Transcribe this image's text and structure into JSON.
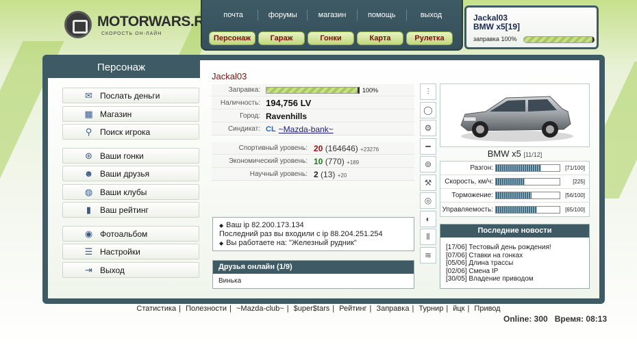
{
  "logo": {
    "title": "MOTORWARS.RU",
    "subtitle": "СКОРОСТЬ ОН-ЛАЙН"
  },
  "topnav": {
    "links": [
      "почта",
      "форумы",
      "магазин",
      "помощь",
      "выход"
    ],
    "buttons": [
      "Персонаж",
      "Гараж",
      "Гонки",
      "Карта",
      "Рулетка"
    ]
  },
  "userbox": {
    "name": "Jackal03",
    "car": "BMW x5[19]",
    "fuel_label": "заправка 100%",
    "fuel_fraction": 1.0
  },
  "sidebar": {
    "title": "Персонаж",
    "groups": [
      [
        {
          "label": "Послать деньги",
          "icon": "money-icon"
        },
        {
          "label": "Магазин",
          "icon": "shop-icon"
        },
        {
          "label": "Поиск игрока",
          "icon": "search-icon"
        }
      ],
      [
        {
          "label": "Ваши гонки",
          "icon": "steering-wheel-icon"
        },
        {
          "label": "Ваши друзья",
          "icon": "friends-icon"
        },
        {
          "label": "Ваши клубы",
          "icon": "globe-icon"
        },
        {
          "label": "Ваш рейтинг",
          "icon": "chart-icon"
        }
      ],
      [
        {
          "label": "Фотоальбом",
          "icon": "camera-icon"
        },
        {
          "label": "Настройки",
          "icon": "sliders-icon"
        },
        {
          "label": "Выход",
          "icon": "exit-icon"
        }
      ]
    ]
  },
  "character": {
    "name": "Jackal03",
    "fuel": {
      "label": "Заправка:",
      "percent": "100%",
      "fraction": 1.0
    },
    "cash": {
      "label": "Наличность:",
      "value": "194,756 LV"
    },
    "city": {
      "label": "Город:",
      "value": "Ravenhills"
    },
    "syndicate": {
      "label": "Синдикат:",
      "tag": "CL",
      "value": "~Mazda-bank~"
    },
    "levels": [
      {
        "label": "Спортивный уровень:",
        "level": "20",
        "points": "(164646)",
        "gain": "+23276",
        "color": "red"
      },
      {
        "label": "Экономический уровень:",
        "level": "10",
        "points": "(770)",
        "gain": "+189",
        "color": "green"
      },
      {
        "label": "Научный уровень:",
        "level": "2",
        "points": "(13)",
        "gain": "+20",
        "color": "dark"
      }
    ]
  },
  "ip": {
    "current": "Ваш ip 82.200.173.134",
    "last": "Последний раз вы входили с ip 88.204.251.254",
    "work": "Вы работаете на: \"Железный рудник\""
  },
  "friends": {
    "title": "Друзья онлайн (1/9)",
    "list": "Винька"
  },
  "car": {
    "name": "BMW x5",
    "slots": "[11/12]",
    "stats": [
      {
        "label": "Разгон:",
        "value": "[71/100]",
        "fraction": 0.71
      },
      {
        "label": "Скорость, км/ч:",
        "value": "[225]",
        "fraction": 0.45
      },
      {
        "label": "Торможение:",
        "value": "[56/100]",
        "fraction": 0.56
      },
      {
        "label": "Управляемость:",
        "value": "[65/100]",
        "fraction": 0.65
      }
    ]
  },
  "parts_icons": [
    "shock-absorber-icon",
    "tire-icon",
    "engine-icon",
    "exhaust-icon",
    "rim-icon",
    "gearbox-icon",
    "turbo-icon",
    "brake-icon",
    "suspension-icon",
    "spring-icon"
  ],
  "news": {
    "title": "Последние новости",
    "items": [
      "[17/06] Тестовый день рождения!",
      "[07/06] Ставки на гонках",
      "[05/06] Длина трассы",
      "[02/06] Смена IP",
      "[30/05] Владение приводом"
    ]
  },
  "footer": {
    "links": [
      "Статистика",
      "Полезности",
      "~Mazda-club~",
      "$uper$tars",
      "Рейтинг",
      "Заправка",
      "Турнир",
      "йцк",
      "Привод"
    ],
    "online": "Online: 300",
    "time": "Время: 08:13"
  },
  "colors": {
    "panel": "#3e5a64",
    "accent_green": "#bfd77c",
    "name_red": "#7a1010"
  }
}
